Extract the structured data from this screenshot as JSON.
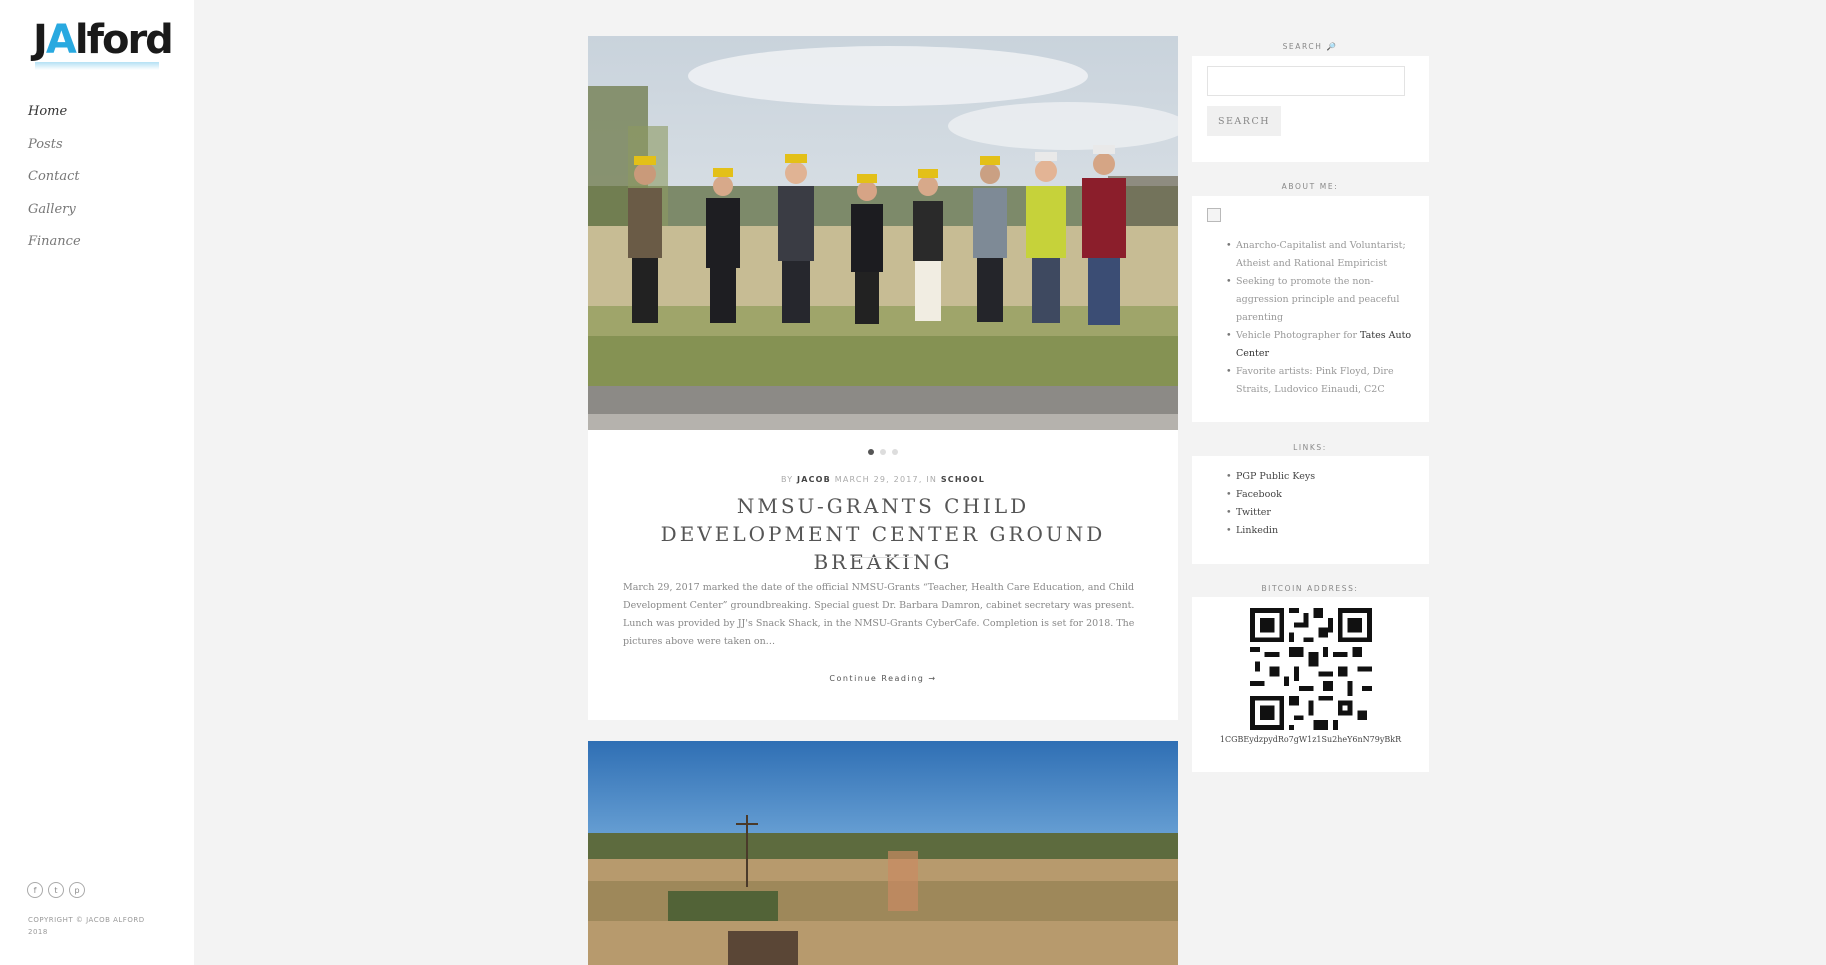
{
  "site": {
    "logo_text_1": "J",
    "logo_text_2": "A",
    "logo_text_3": "lford"
  },
  "nav": {
    "items": [
      {
        "label": "Home",
        "active": true
      },
      {
        "label": "Posts",
        "active": false
      },
      {
        "label": "Contact",
        "active": false
      },
      {
        "label": "Gallery",
        "active": false
      },
      {
        "label": "Finance",
        "active": false
      }
    ]
  },
  "footer": {
    "social_icons": [
      "facebook-icon",
      "twitter-icon",
      "pinterest-icon"
    ],
    "social_glyphs": [
      "f",
      "t",
      "p"
    ],
    "copyright_line1": "Copyright © Jacob Alford",
    "copyright_line2": "2018"
  },
  "post1": {
    "meta_by": "By",
    "author": "Jacob",
    "date": "March 29, 2017",
    "meta_in": ", In",
    "category": "School",
    "title": "NMSU-Grants Child Development Center Ground Breaking",
    "excerpt": "March 29, 2017 marked the date of the official NMSU-Grants “Teacher, Health Care Education, and Child Development Center” groundbreaking.  Special guest Dr. Barbara Damron, cabinet secretary was present.  Lunch was provided by JJ's Snack Shack, in the NMSU-Grants CyberCafe.  Completion is set for 2018. The pictures above were taken on…",
    "continue_label": "Continue Reading →",
    "slider_dots": 3,
    "slider_active": 0
  },
  "widgets": {
    "search": {
      "title": "Search 🔎",
      "placeholder": "",
      "button_label": "Search"
    },
    "about": {
      "title": "About Me:",
      "item1": "Anarcho-Capitalist and Voluntarist; Atheist and Rational Empiricist",
      "item2": "Seeking to promote the non-aggression principle and peaceful parenting",
      "item3_pre": "Vehicle Photographer for ",
      "item3_link": "Tates Auto Center",
      "item4": "Favorite artists: Pink Floyd, Dire Straits, Ludovico Einaudi, C2C"
    },
    "links": {
      "title": "Links:",
      "items": [
        "PGP Public Keys",
        "Facebook",
        "Twitter",
        "Linkedin"
      ]
    },
    "bitcoin": {
      "title": "Bitcoin Address:",
      "address": "1CGBEydzpydRo7gW1z1Su2heY6nN79yBkR"
    }
  },
  "colors": {
    "accent": "#29a9e0",
    "page_bg": "#f3f3f3",
    "card_bg": "#ffffff"
  }
}
